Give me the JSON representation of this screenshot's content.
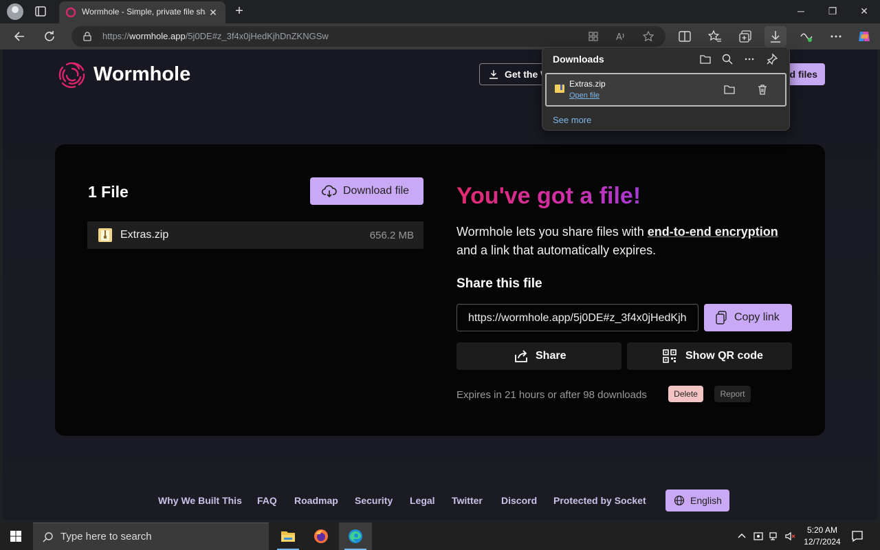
{
  "browser": {
    "tab_title": "Wormhole - Simple, private file sharing",
    "url_prefix": "https://",
    "url_host": "wormhole.app",
    "url_path": "/5j0DE#z_3f4x0jHedKjhDnZKNGSw"
  },
  "header": {
    "brand": "Wormhole",
    "get_app_label": "Get the W",
    "send_label": "d files"
  },
  "card": {
    "files_count": "1 File",
    "download_button": "Download file",
    "file": {
      "name": "Extras.zip",
      "size": "656.2 MB"
    },
    "headline": "You've got a file!",
    "desc_before": "Wormhole lets you share files with ",
    "desc_emph": "end-to-end encryption",
    "desc_after": " and a link that automatically expires.",
    "share_title": "Share this file",
    "share_link": "https://wormhole.app/5j0DE#z_3f4x0jHedKjh",
    "copy_label": "Copy link",
    "share_label": "Share",
    "qr_label": "Show QR code",
    "expires": "Expires in 21 hours or after 98 downloads",
    "delete_label": "Delete",
    "report_label": "Report"
  },
  "footer": {
    "links": [
      "Why We Built This",
      "FAQ",
      "Roadmap",
      "Security",
      "Legal",
      "Twitter",
      "Discord",
      "Protected by Socket"
    ],
    "language": "English"
  },
  "downloads_flyout": {
    "title": "Downloads",
    "item_name": "Extras.zip",
    "item_action": "Open file",
    "see_more": "See more"
  },
  "taskbar": {
    "search_placeholder": "Type here to search",
    "time": "5:20 AM",
    "date": "12/7/2024"
  },
  "colors": {
    "accent_purple": "#c9a9f5",
    "headline_pink": "#e22a6f",
    "link_blue": "#7fb6ea"
  }
}
